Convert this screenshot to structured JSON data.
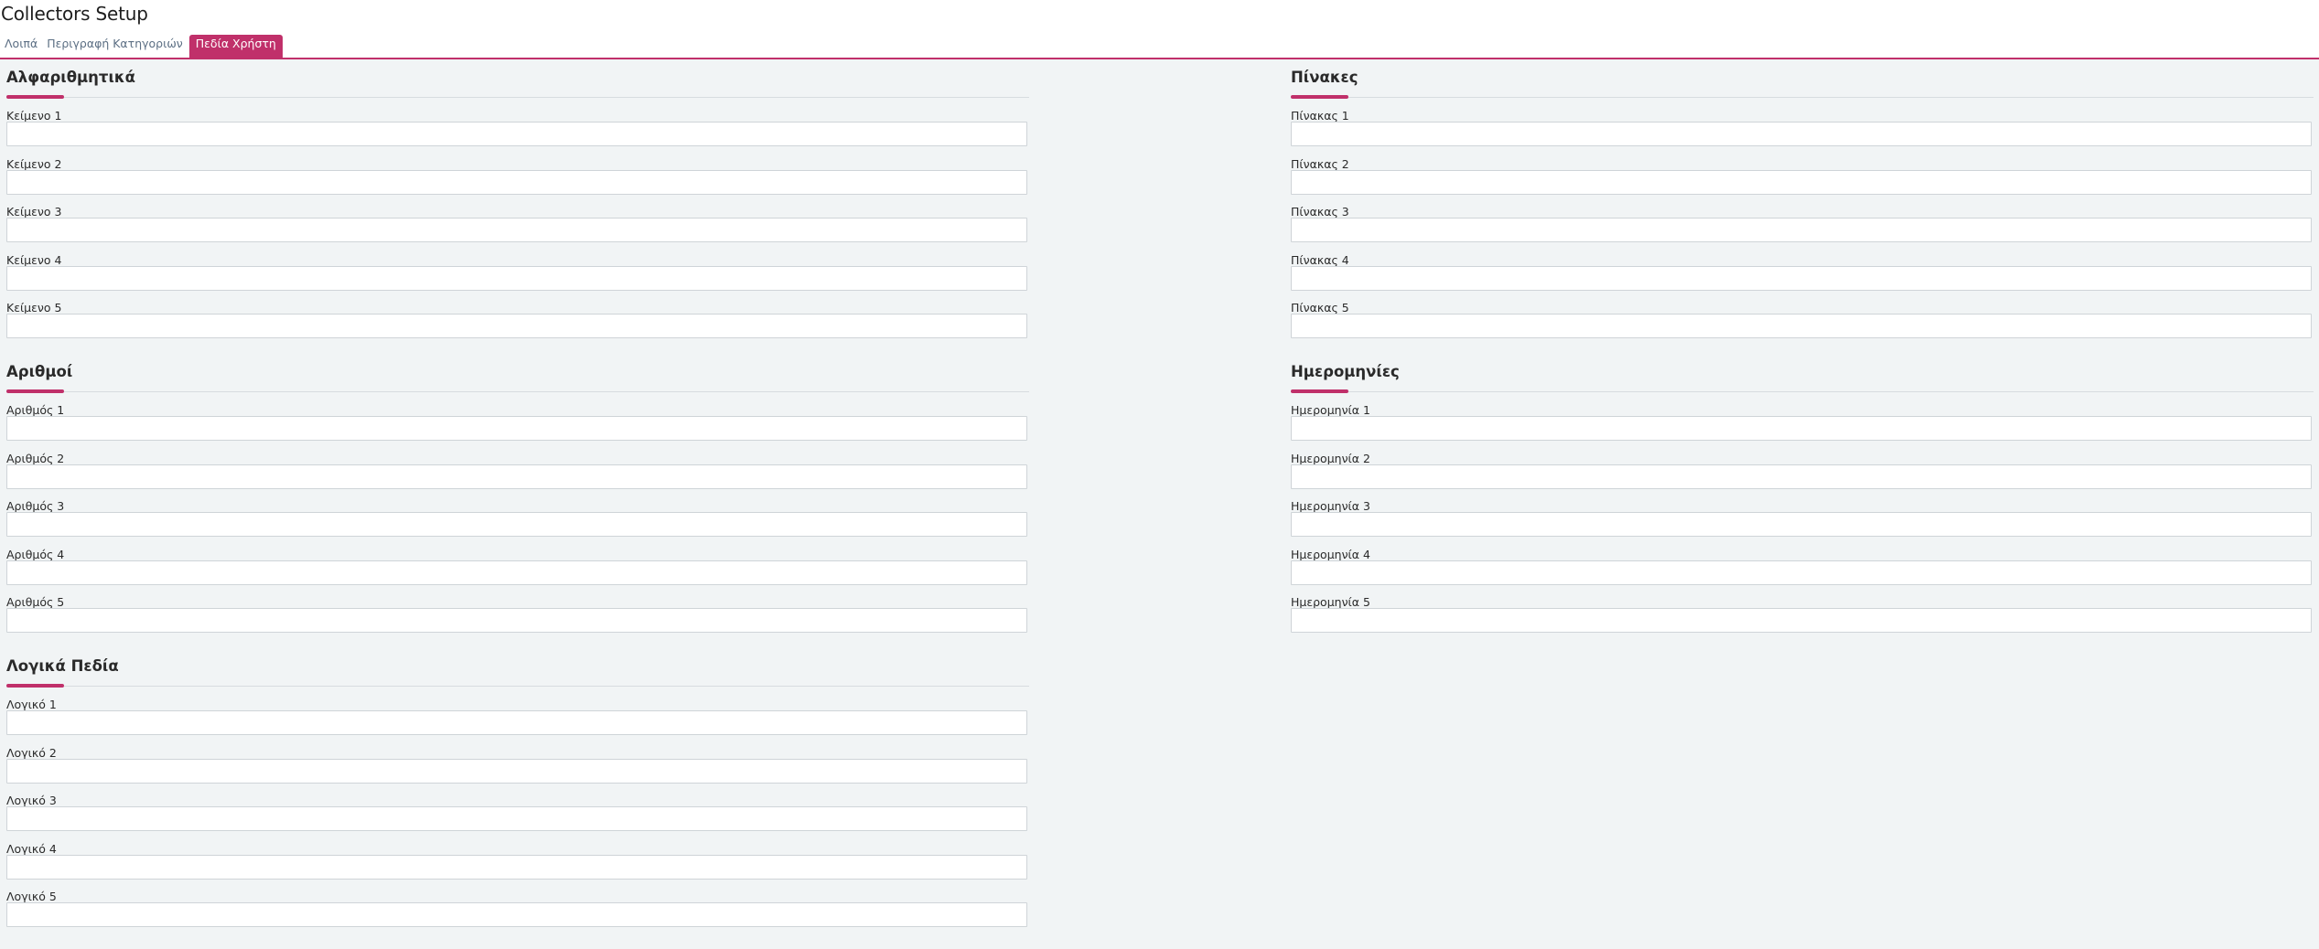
{
  "page": {
    "title": "Collectors Setup"
  },
  "tabs": [
    {
      "label": "Λοιπά"
    },
    {
      "label": "Περιγραφή Κατηγοριών"
    },
    {
      "label": "Πεδία Χρήστη"
    }
  ],
  "colors": {
    "accent": "#c0306a",
    "background": "#f1f4f5"
  },
  "sections": {
    "alpha": {
      "title": "Αλφαριθμητικά",
      "fields": [
        {
          "label": "Κείμενο 1",
          "value": ""
        },
        {
          "label": "Κείμενο 2",
          "value": ""
        },
        {
          "label": "Κείμενο 3",
          "value": ""
        },
        {
          "label": "Κείμενο 4",
          "value": ""
        },
        {
          "label": "Κείμενο 5",
          "value": ""
        }
      ]
    },
    "numbers": {
      "title": "Αριθμοί",
      "fields": [
        {
          "label": "Αριθμός 1",
          "value": ""
        },
        {
          "label": "Αριθμός 2",
          "value": ""
        },
        {
          "label": "Αριθμός 3",
          "value": ""
        },
        {
          "label": "Αριθμός 4",
          "value": ""
        },
        {
          "label": "Αριθμός 5",
          "value": ""
        }
      ]
    },
    "logical": {
      "title": "Λογικά Πεδία",
      "fields": [
        {
          "label": "Λογικό 1",
          "value": ""
        },
        {
          "label": "Λογικό 2",
          "value": ""
        },
        {
          "label": "Λογικό 3",
          "value": ""
        },
        {
          "label": "Λογικό 4",
          "value": ""
        },
        {
          "label": "Λογικό 5",
          "value": ""
        }
      ]
    },
    "tables": {
      "title": "Πίνακες",
      "fields": [
        {
          "label": "Πίνακας 1",
          "value": ""
        },
        {
          "label": "Πίνακας 2",
          "value": ""
        },
        {
          "label": "Πίνακας 3",
          "value": ""
        },
        {
          "label": "Πίνακας 4",
          "value": ""
        },
        {
          "label": "Πίνακας 5",
          "value": ""
        }
      ]
    },
    "dates": {
      "title": "Ημερομηνίες",
      "fields": [
        {
          "label": "Ημερομηνία 1",
          "value": ""
        },
        {
          "label": "Ημερομηνία 2",
          "value": ""
        },
        {
          "label": "Ημερομηνία 3",
          "value": ""
        },
        {
          "label": "Ημερομηνία 4",
          "value": ""
        },
        {
          "label": "Ημερομηνία 5",
          "value": ""
        }
      ]
    }
  }
}
